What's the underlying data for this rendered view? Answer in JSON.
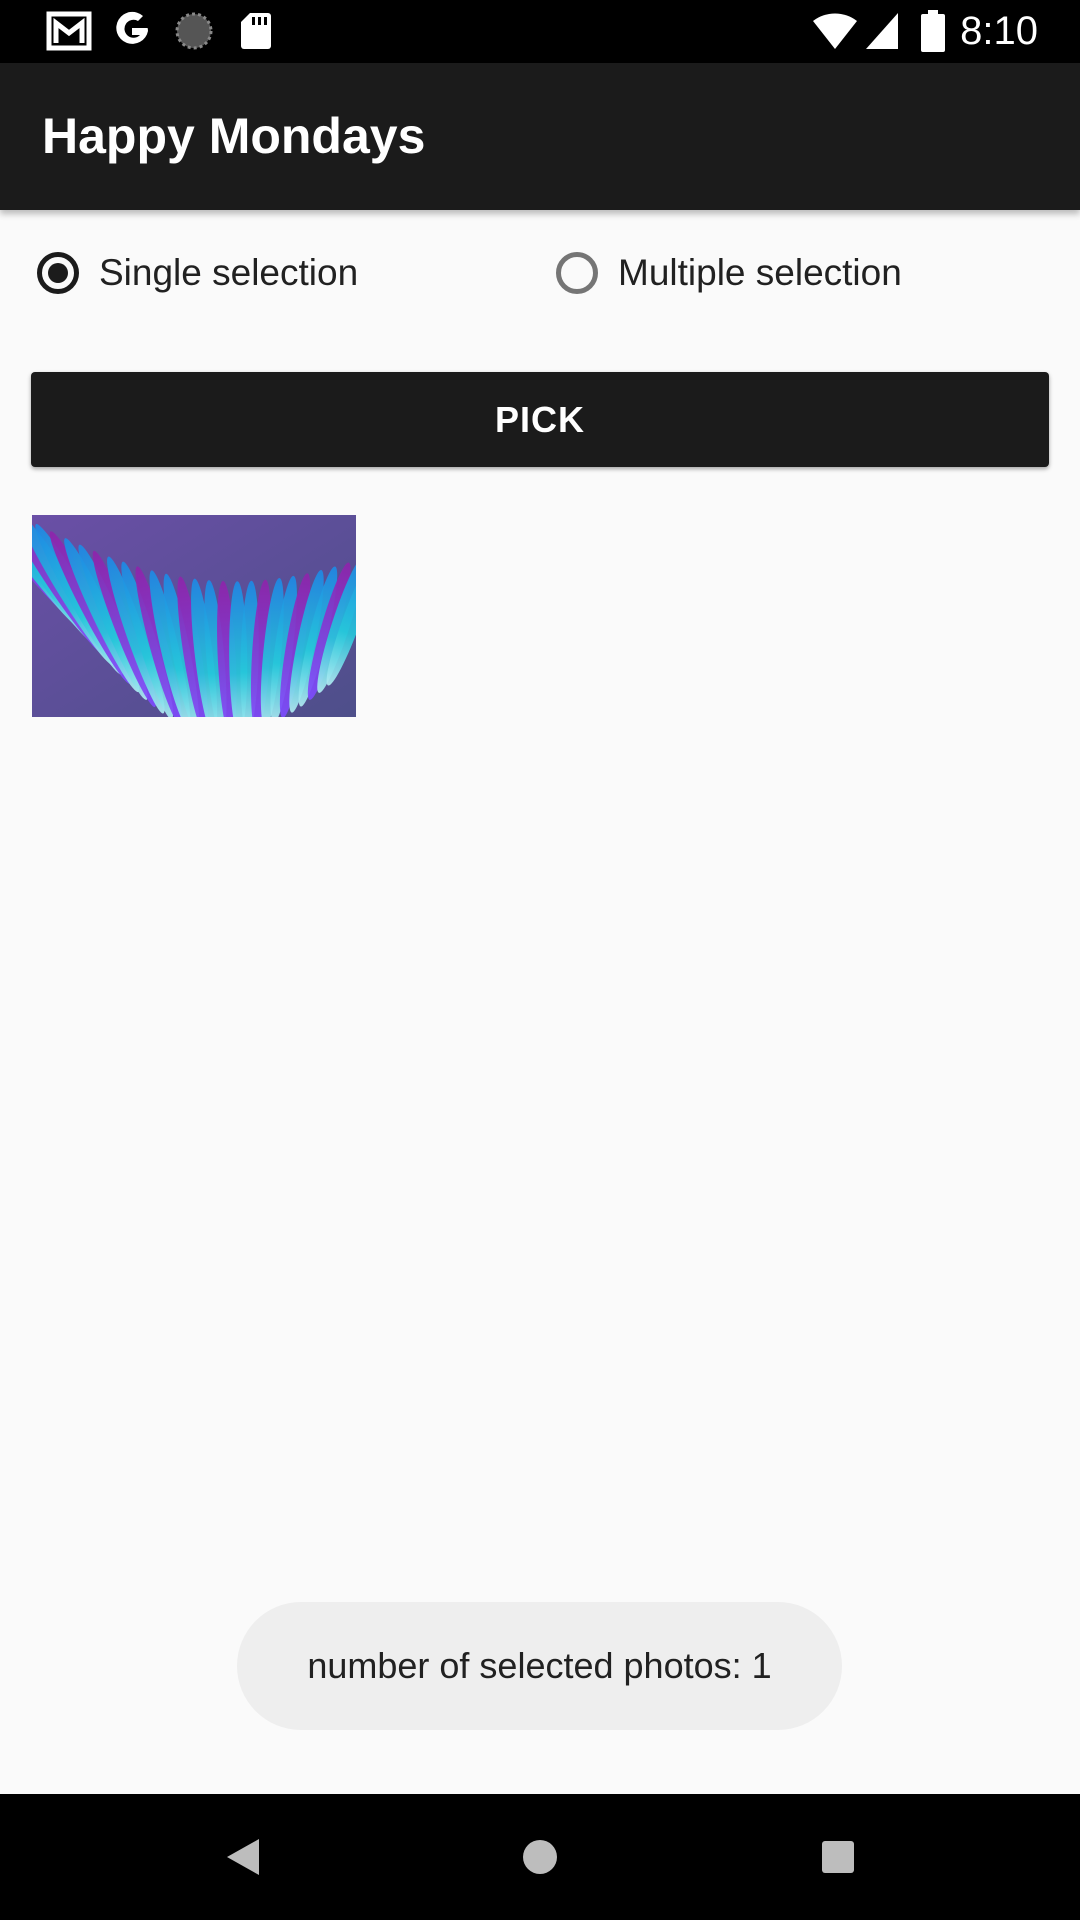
{
  "status_bar": {
    "time": "8:10",
    "left_icons": [
      "gmail-icon",
      "google-icon",
      "sync-icon",
      "sd-card-icon"
    ],
    "right_icons": [
      "wifi-icon",
      "cell-signal-icon",
      "battery-icon"
    ]
  },
  "app_bar": {
    "title": "Happy Mondays",
    "background": "#1b1b1b"
  },
  "selection_mode": {
    "options": [
      {
        "label": "Single selection",
        "checked": true
      },
      {
        "label": "Multiple selection",
        "checked": false
      }
    ]
  },
  "pick_button": {
    "label": "PICK"
  },
  "selected_photos": [
    {
      "icon": "abstract-feather-wallpaper-thumbnail"
    }
  ],
  "toast": {
    "text": "number of selected photos: 1"
  },
  "nav_bar": {
    "buttons": [
      "back-icon",
      "home-icon",
      "recents-icon"
    ]
  }
}
